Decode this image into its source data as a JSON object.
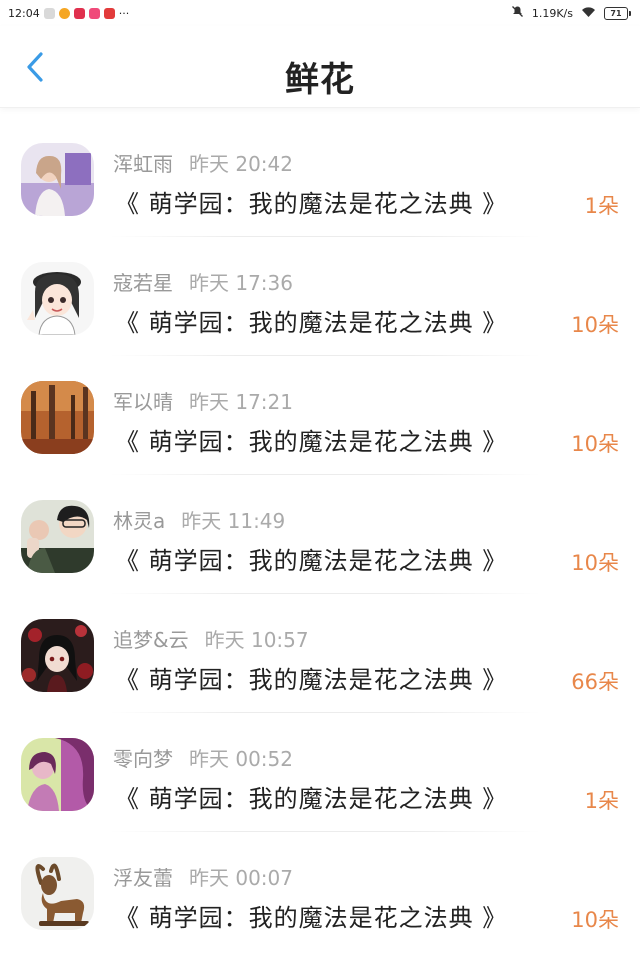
{
  "status_bar": {
    "time": "12:04",
    "more": "···",
    "net_speed": "1.19K/s",
    "battery": "71"
  },
  "header": {
    "title": "鲜花"
  },
  "colors": {
    "accent_blue": "#3a9be6",
    "amount_orange": "#e8874a",
    "meta_gray": "#999999"
  },
  "records": [
    {
      "name": "浑虹雨",
      "time": "昨天 20:42",
      "book": "《 萌学园：我的魔法是花之法典 》",
      "amount": "1朵"
    },
    {
      "name": "寇若星",
      "time": "昨天 17:36",
      "book": "《 萌学园：我的魔法是花之法典 》",
      "amount": "10朵"
    },
    {
      "name": "军以晴",
      "time": "昨天 17:21",
      "book": "《 萌学园：我的魔法是花之法典 》",
      "amount": "10朵"
    },
    {
      "name": "林灵a",
      "time": "昨天 11:49",
      "book": "《 萌学园：我的魔法是花之法典 》",
      "amount": "10朵"
    },
    {
      "name": "追梦&云",
      "time": "昨天 10:57",
      "book": "《 萌学园：我的魔法是花之法典 》",
      "amount": "66朵"
    },
    {
      "name": "零向梦",
      "time": "昨天 00:52",
      "book": "《 萌学园：我的魔法是花之法典 》",
      "amount": "1朵"
    },
    {
      "name": "浮友蕾",
      "time": "昨天 00:07",
      "book": "《 萌学园：我的魔法是花之法典 》",
      "amount": "10朵"
    }
  ]
}
